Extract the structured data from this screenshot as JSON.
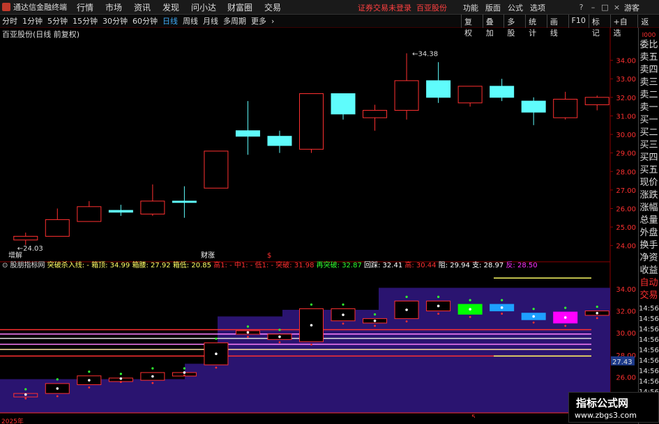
{
  "app": {
    "title": "通达信金融终端"
  },
  "menu": [
    "行情",
    "市场",
    "资讯",
    "发现",
    "问小达",
    "财富圈",
    "交易"
  ],
  "notice": "证券交易未登录",
  "stock_tag": "百亚股份",
  "tools": [
    "功能",
    "版面",
    "公式",
    "选项"
  ],
  "guest": "游客",
  "periods": [
    "分时",
    "1分钟",
    "5分钟",
    "15分钟",
    "30分钟",
    "60分钟",
    "日线",
    "周线",
    "月线",
    "多周期",
    "更多"
  ],
  "active_period": "日线",
  "right_tools": [
    "复权",
    "叠加",
    "多股",
    "统计",
    "画线",
    "F10",
    "标记",
    "+自选",
    "返回"
  ],
  "chart_title": "百亚股份(日线 前复权)",
  "main_chart": {
    "ylim": [
      23.5,
      35.0
    ],
    "yticks": [
      "34.00",
      "33.00",
      "32.00",
      "31.00",
      "30.00",
      "29.00",
      "28.00",
      "27.00",
      "26.00",
      "25.00",
      "24.00"
    ],
    "candles": [
      {
        "o": 24.3,
        "c": 24.5,
        "h": 24.7,
        "l": 24.03,
        "up": true
      },
      {
        "o": 24.5,
        "c": 25.4,
        "h": 26.0,
        "l": 24.5,
        "up": true
      },
      {
        "o": 25.3,
        "c": 26.1,
        "h": 26.4,
        "l": 25.3,
        "up": true
      },
      {
        "o": 25.9,
        "c": 25.8,
        "h": 26.2,
        "l": 25.6,
        "up": false
      },
      {
        "o": 25.7,
        "c": 26.4,
        "h": 27.3,
        "l": 25.6,
        "up": true
      },
      {
        "o": 26.4,
        "c": 26.4,
        "h": 27.2,
        "l": 25.5,
        "up": false
      },
      {
        "o": 27.1,
        "c": 29.1,
        "h": 29.1,
        "l": 27.1,
        "up": true
      },
      {
        "o": 30.2,
        "c": 29.9,
        "h": 31.8,
        "l": 28.9,
        "up": false
      },
      {
        "o": 29.9,
        "c": 29.4,
        "h": 30.2,
        "l": 29.0,
        "up": false
      },
      {
        "o": 29.2,
        "c": 32.2,
        "h": 32.2,
        "l": 29.0,
        "up": true
      },
      {
        "o": 32.2,
        "c": 31.1,
        "h": 32.2,
        "l": 30.8,
        "up": false
      },
      {
        "o": 30.9,
        "c": 31.3,
        "h": 31.6,
        "l": 30.2,
        "up": true
      },
      {
        "o": 31.3,
        "c": 32.9,
        "h": 34.38,
        "l": 30.8,
        "up": true
      },
      {
        "o": 32.9,
        "c": 32.0,
        "h": 33.9,
        "l": 31.7,
        "up": false
      },
      {
        "o": 31.7,
        "c": 32.6,
        "h": 32.6,
        "l": 31.5,
        "up": true
      },
      {
        "o": 32.6,
        "c": 32.0,
        "h": 33.0,
        "l": 31.8,
        "up": false
      },
      {
        "o": 31.8,
        "c": 31.2,
        "h": 32.0,
        "l": 30.5,
        "up": false
      },
      {
        "o": 30.9,
        "c": 31.9,
        "h": 32.3,
        "l": 30.8,
        "up": true
      },
      {
        "o": 31.6,
        "c": 32.0,
        "h": 32.1,
        "l": 31.3,
        "up": true
      }
    ],
    "high_label": "34.38",
    "low_label": "24.03",
    "event_labels": [
      "增解",
      "财涨",
      "$"
    ]
  },
  "indicator": {
    "name": "股朋指标网",
    "params": [
      {
        "label": "突破杀入线: -",
        "color": "#ffff66"
      },
      {
        "label": "箱顶: 34.99",
        "color": "#ffff66"
      },
      {
        "label": "箱腰: 27.92",
        "color": "#ffff66"
      },
      {
        "label": "箱低: 20.85",
        "color": "#ffff66"
      },
      {
        "label": "高1: -",
        "color": "#ff3030"
      },
      {
        "label": "中1: -",
        "color": "#ff3030"
      },
      {
        "label": "低1: -",
        "color": "#ff3030"
      },
      {
        "label": "突破: 31.98",
        "color": "#ff3030"
      },
      {
        "label": "再突破: 32.87",
        "color": "#30ff30"
      },
      {
        "label": "回踩: 32.41",
        "color": "#ffffff"
      },
      {
        "label": "高: 30.44",
        "color": "#ff3030"
      },
      {
        "label": "阻: 29.94",
        "color": "#ffffff"
      },
      {
        "label": "支: 28.97",
        "color": "#ffffff"
      },
      {
        "label": "反: 28.50",
        "color": "#ff30ff"
      }
    ],
    "ylim": [
      22.8,
      35.2
    ],
    "yticks": [
      "34.00",
      "32.00",
      "30.00",
      "28.00",
      "26.00",
      "24.00"
    ],
    "right_value": "27.43",
    "box_colors": {
      "bg": "#2a1470",
      "green": "#00ff00",
      "blue": "#1ea0ff",
      "magenta": "#ff00ff"
    }
  },
  "right_panel": [
    "委比",
    "卖五",
    "卖四",
    "卖三",
    "卖二",
    "卖一",
    "买一",
    "买二",
    "买三",
    "买四",
    "买五",
    "现价",
    "涨跌",
    "涨幅",
    "总量",
    "外盘",
    "换手",
    "净资",
    "收益",
    "自动",
    "交易"
  ],
  "right_times": [
    "14:56",
    "14:56",
    "14:56",
    "14:56",
    "14:56",
    "14:56",
    "14:56",
    "14:56",
    "14:56",
    "14:56"
  ],
  "year_label": "2025年",
  "month_label": "5",
  "watermark": {
    "line1": "指标公式网",
    "line2": "www.zbgs3.com"
  }
}
